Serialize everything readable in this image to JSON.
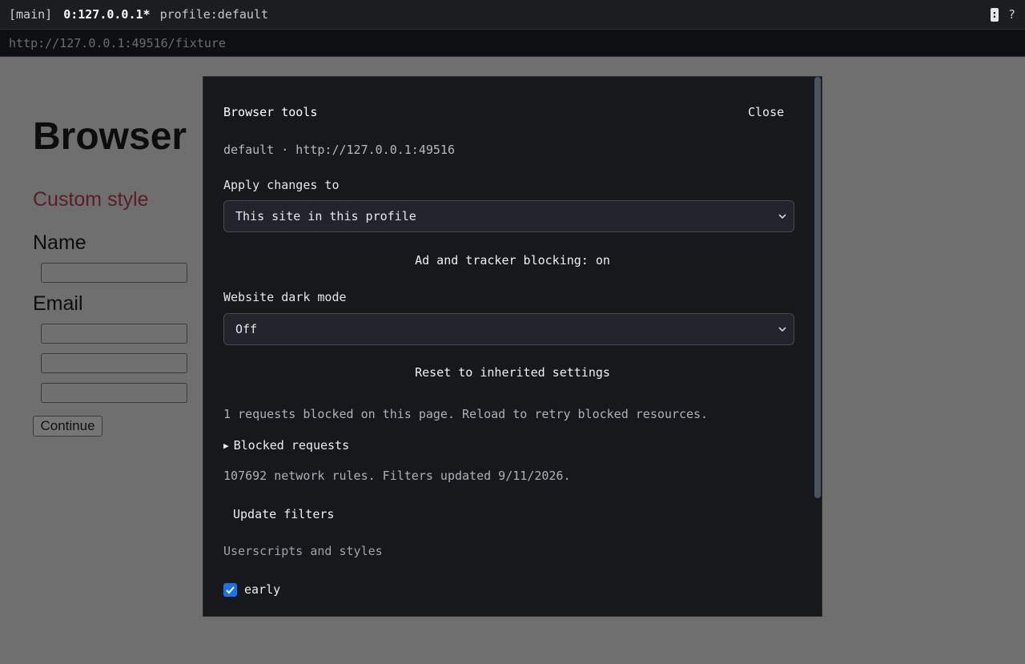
{
  "topbar": {
    "session": "[main]",
    "tab": "0:127.0.0.1*",
    "profile": "profile:default",
    "key_colon": ":",
    "key_help": "?"
  },
  "urlbar": {
    "url": "http://127.0.0.1:49516/fixture"
  },
  "page": {
    "heading": "Browser",
    "custom_style": "Custom style",
    "name_label": "Name",
    "email_label": "Email",
    "continue_label": "Continue"
  },
  "dialog": {
    "title": "Browser tools",
    "close_label": "Close",
    "subtitle": "default · http://127.0.0.1:49516",
    "apply_label": "Apply changes to",
    "apply_value": "This site in this profile",
    "blocking_status": "Ad and tracker blocking: on",
    "dark_mode_label": "Website dark mode",
    "dark_mode_value": "Off",
    "reset_label": "Reset to inherited settings",
    "blocked_summary_text": "1 requests blocked on this page. Reload to retry blocked resources.",
    "blocked_requests_label": "Blocked requests",
    "rules_text": "107692 network rules. Filters updated 9/11/2026.",
    "update_filters_label": "Update filters",
    "userscripts_heading": "Userscripts and styles",
    "userscript_item": "early",
    "userscript_checked": true
  },
  "colors": {
    "accent": "#1a73e8",
    "dialog_bg": "#17181c",
    "page_bg": "#6f6f6f",
    "custom_style_text": "#5a1e25"
  }
}
